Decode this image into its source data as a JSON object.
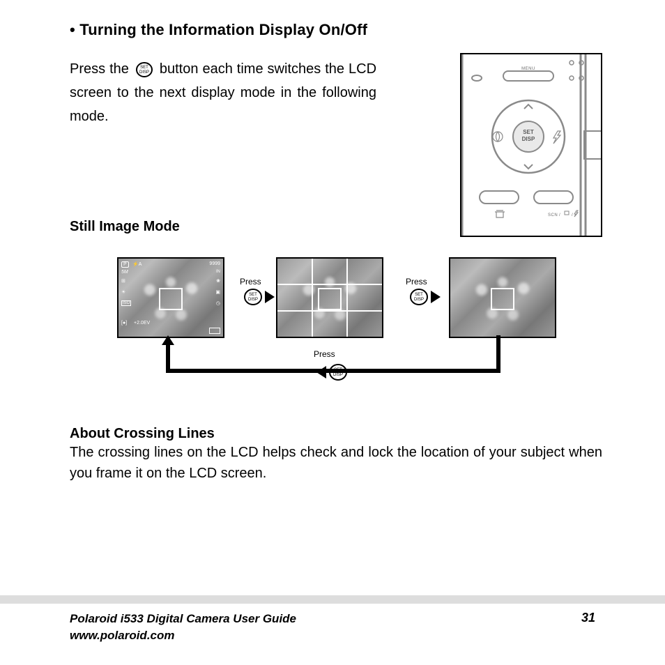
{
  "section": {
    "bullet": "•",
    "title": "Turning the Information Display On/Off"
  },
  "body": {
    "p1a": "Press the",
    "p1b": "button each time switches the LCD screen to the next display mode in the following mode."
  },
  "icon_label": {
    "top": "SET",
    "bottom": "DISP"
  },
  "camera": {
    "menu": "MENU",
    "set": "SET",
    "disp": "DISP",
    "scn": "SCN"
  },
  "subsection1": "Still Image Mode",
  "flow": {
    "press": "Press",
    "osd": {
      "p": "P",
      "flash_auto": "A",
      "shots": "9999",
      "size": "5M",
      "in": "IN",
      "iso": "ISO",
      "ev": "+2.0EV"
    }
  },
  "about": {
    "heading": "About Crossing Lines",
    "body": "The crossing lines on the LCD helps check and lock the location of your subject when you frame it on the LCD screen."
  },
  "footer": {
    "guide": "Polaroid i533 Digital Camera User Guide",
    "url": "www.polaroid.com",
    "page": "31"
  }
}
